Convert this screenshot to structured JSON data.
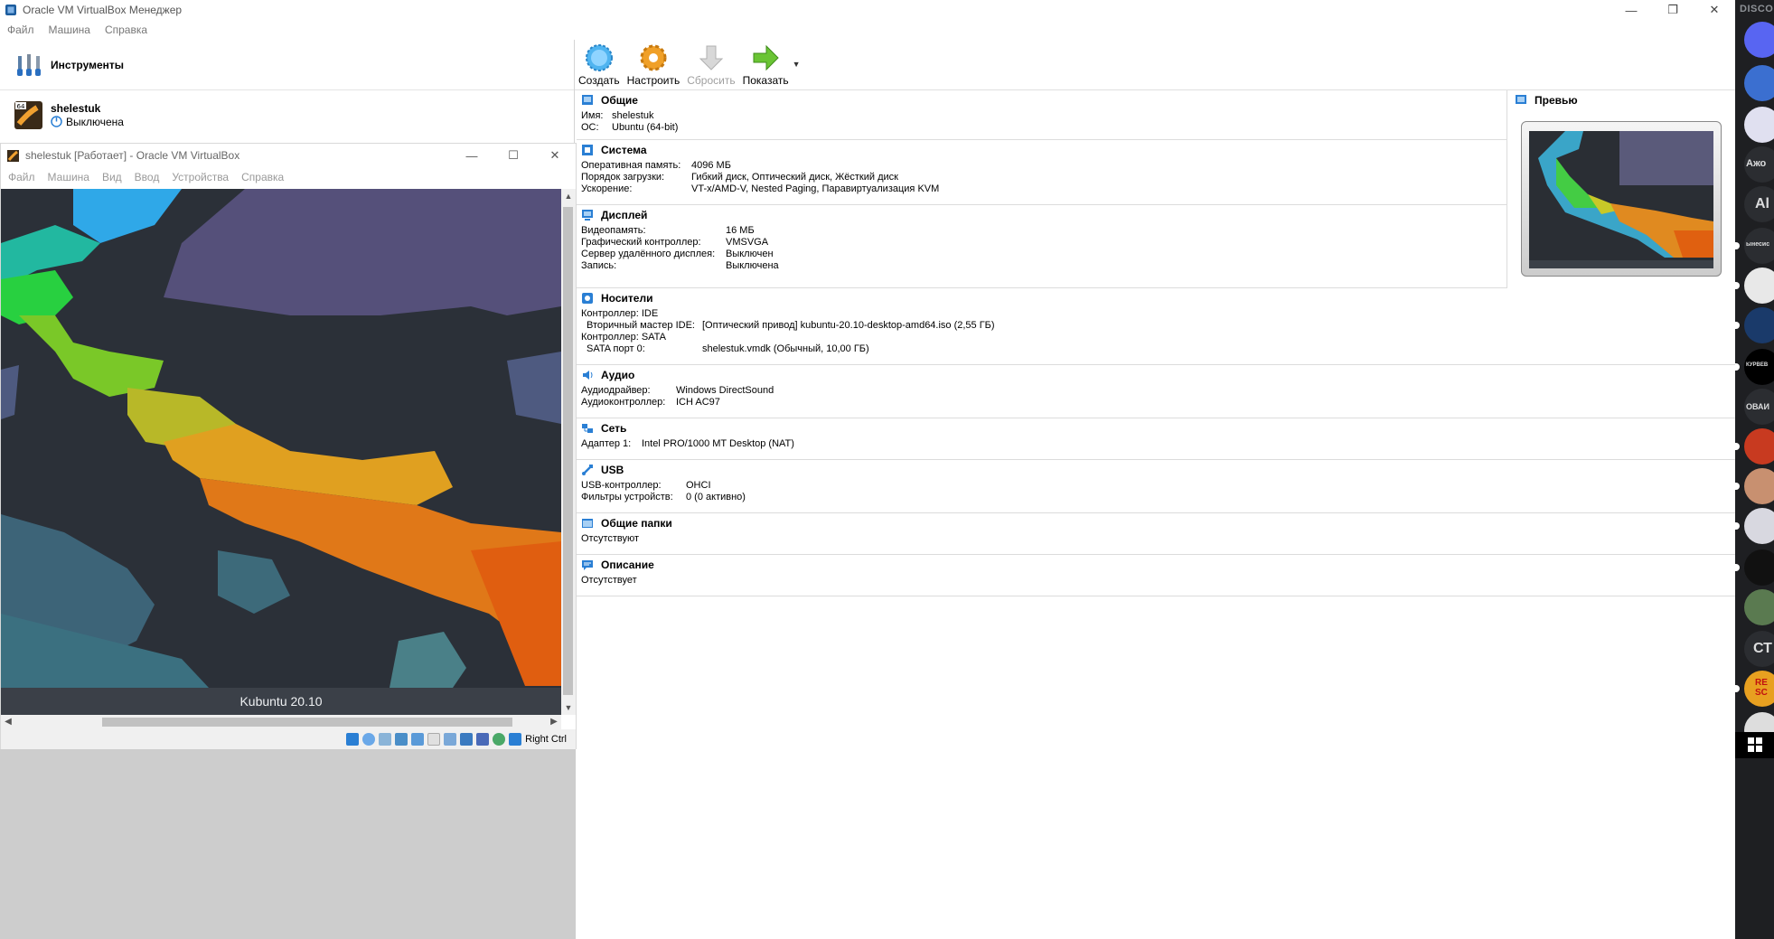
{
  "manager": {
    "title": "Oracle VM VirtualBox Менеджер",
    "menu": [
      "Файл",
      "Машина",
      "Справка"
    ],
    "tools_label": "Инструменты",
    "vm": {
      "name": "shelestuk",
      "state": "Выключена",
      "badge": "64"
    }
  },
  "toolbar": {
    "create": "Создать",
    "settings": "Настроить",
    "discard": "Сбросить",
    "show": "Показать"
  },
  "details": {
    "general": {
      "title": "Общие",
      "name_k": "Имя:",
      "name_v": "shelestuk",
      "os_k": "ОС:",
      "os_v": "Ubuntu (64-bit)"
    },
    "system": {
      "title": "Система",
      "ram_k": "Оперативная память:",
      "ram_v": "4096 МБ",
      "boot_k": "Порядок загрузки:",
      "boot_v": "Гибкий диск, Оптический диск, Жёсткий диск",
      "accel_k": "Ускорение:",
      "accel_v": "VT-x/AMD-V, Nested Paging, Паравиртуализация KVM"
    },
    "display": {
      "title": "Дисплей",
      "vram_k": "Видеопамять:",
      "vram_v": "16 МБ",
      "gc_k": "Графический контроллер:",
      "gc_v": "VMSVGA",
      "rds_k": "Сервер удалённого дисплея:",
      "rds_v": "Выключен",
      "rec_k": "Запись:",
      "rec_v": "Выключена"
    },
    "storage": {
      "title": "Носители",
      "c1": "Контроллер: IDE",
      "c1p_k": "Вторичный мастер IDE:",
      "c1p_v": "[Оптический привод] kubuntu-20.10-desktop-amd64.iso (2,55 ГБ)",
      "c2": "Контроллер: SATA",
      "c2p_k": "SATA порт 0:",
      "c2p_v": "shelestuk.vmdk (Обычный, 10,00 ГБ)"
    },
    "audio": {
      "title": "Аудио",
      "drv_k": "Аудиодрайвер:",
      "drv_v": "Windows DirectSound",
      "ctl_k": "Аудиоконтроллер:",
      "ctl_v": "ICH AC97"
    },
    "network": {
      "title": "Сеть",
      "a1_k": "Адаптер 1:",
      "a1_v": "Intel PRO/1000 MT Desktop (NAT)"
    },
    "usb": {
      "title": "USB",
      "ctl_k": "USB-контроллер:",
      "ctl_v": "OHCI",
      "flt_k": "Фильтры устройств:",
      "flt_v": "0 (0 активно)"
    },
    "shared": {
      "title": "Общие папки",
      "value": "Отсутствуют"
    },
    "description": {
      "title": "Описание",
      "value": "Отсутствует"
    }
  },
  "preview": {
    "title": "Превью"
  },
  "vm_window": {
    "title": "shelestuk [Работает] - Oracle VM VirtualBox",
    "menu": [
      "Файл",
      "Машина",
      "Вид",
      "Ввод",
      "Устройства",
      "Справка"
    ],
    "guest_label": "Kubuntu 20.10",
    "host_key": "Right Ctrl"
  },
  "discord": {
    "title": "DISCO",
    "texts": [
      "Ажо",
      "Al",
      "ынесис",
      "КУРВЕВ",
      "ОВАИ",
      "СТ",
      "RE SC"
    ]
  },
  "colors": {
    "accent": "#2a7fd4",
    "guest_bg": "#2b3038"
  }
}
